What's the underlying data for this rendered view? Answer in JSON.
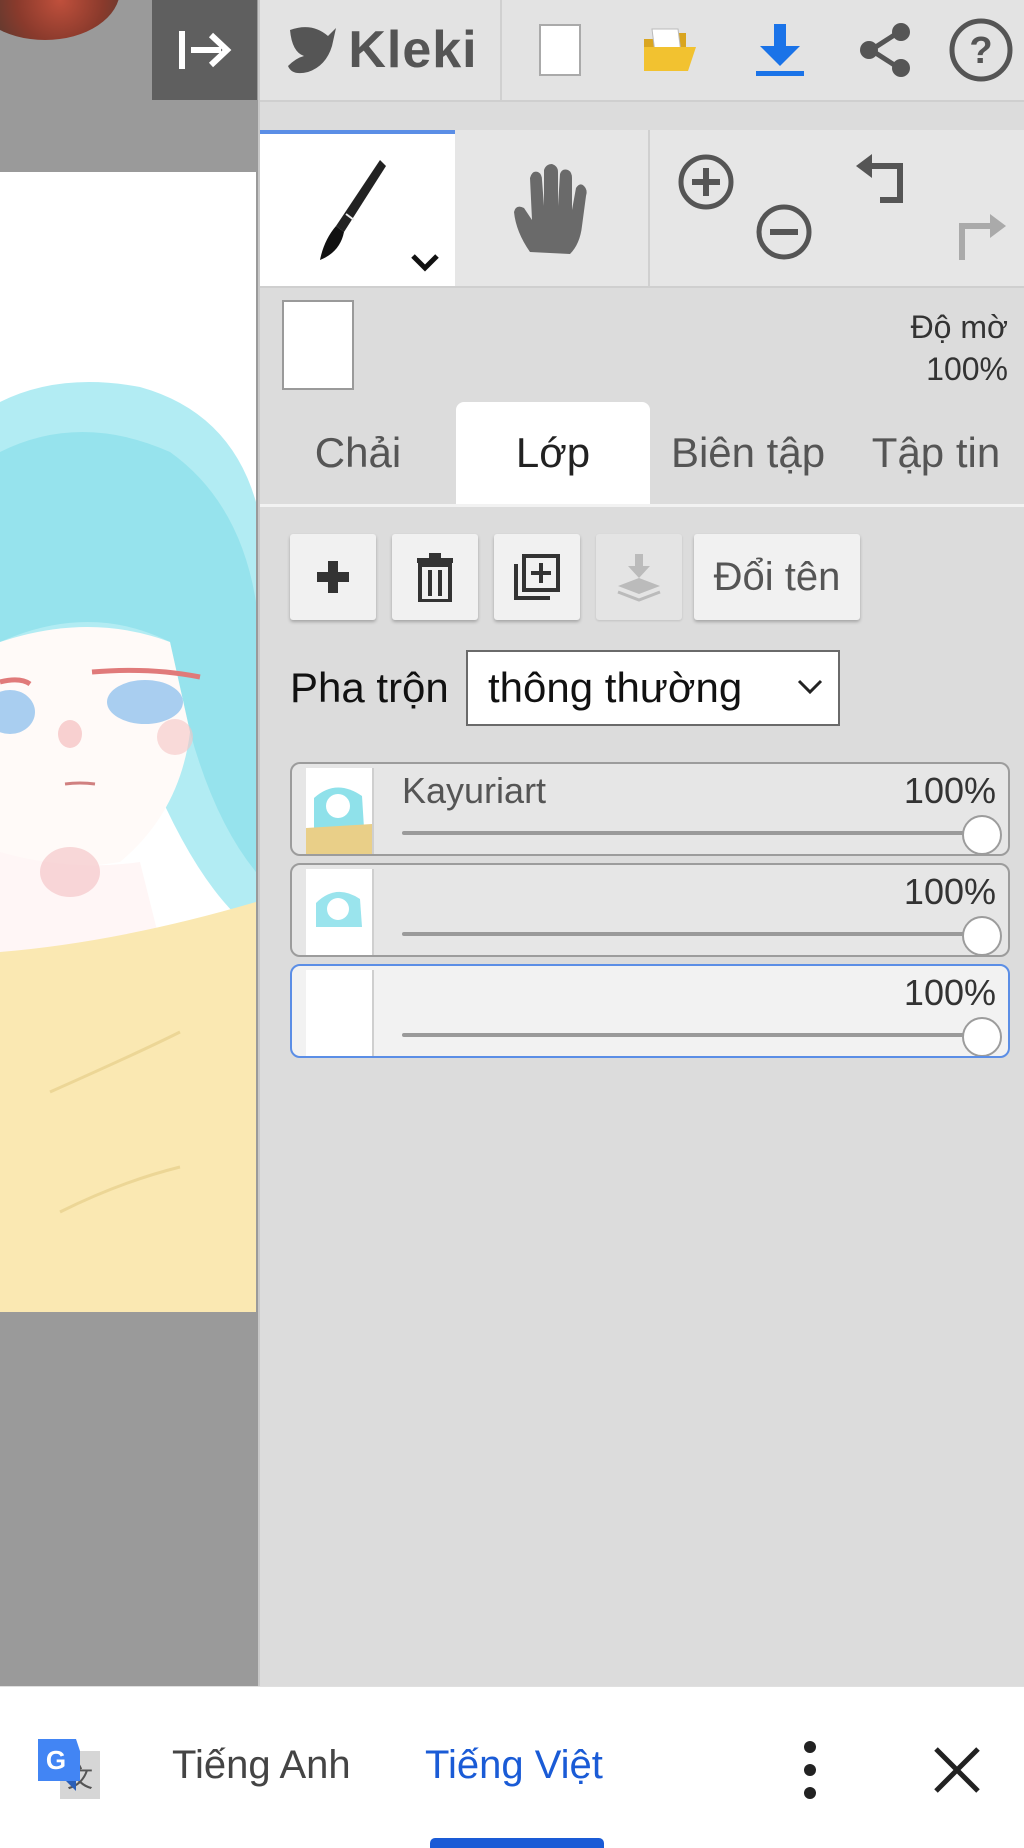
{
  "app": {
    "logo_text": "Kleki"
  },
  "toolbar": {
    "icons": [
      "new-image-icon",
      "open-folder-icon",
      "download-icon",
      "share-icon",
      "help-icon"
    ],
    "accent_color": "#1a73e8"
  },
  "tools": [
    "brush-tool",
    "hand-tool",
    "zoom-in",
    "zoom-out",
    "undo",
    "redo"
  ],
  "opacity": {
    "label": "Độ mờ",
    "value": "100%"
  },
  "tabs": [
    {
      "label": "Chải",
      "active": false
    },
    {
      "label": "Lớp",
      "active": true
    },
    {
      "label": "Biên tập",
      "active": false
    },
    {
      "label": "Tập tin",
      "active": false
    }
  ],
  "layer_actions": {
    "rename_label": "Đổi tên"
  },
  "blend": {
    "label": "Pha trộn",
    "value": "thông thường"
  },
  "layers": [
    {
      "name": "Kayuriart",
      "opacity_label": "100%",
      "opacity": 1.0,
      "selected": false
    },
    {
      "name": "",
      "opacity_label": "100%",
      "opacity": 1.0,
      "selected": false
    },
    {
      "name": "",
      "opacity_label": "100%",
      "opacity": 1.0,
      "selected": true
    }
  ],
  "translate_bar": {
    "source_lang": "Tiếng Anh",
    "target_lang": "Tiếng Việt",
    "active_color": "#1a5bd6"
  }
}
